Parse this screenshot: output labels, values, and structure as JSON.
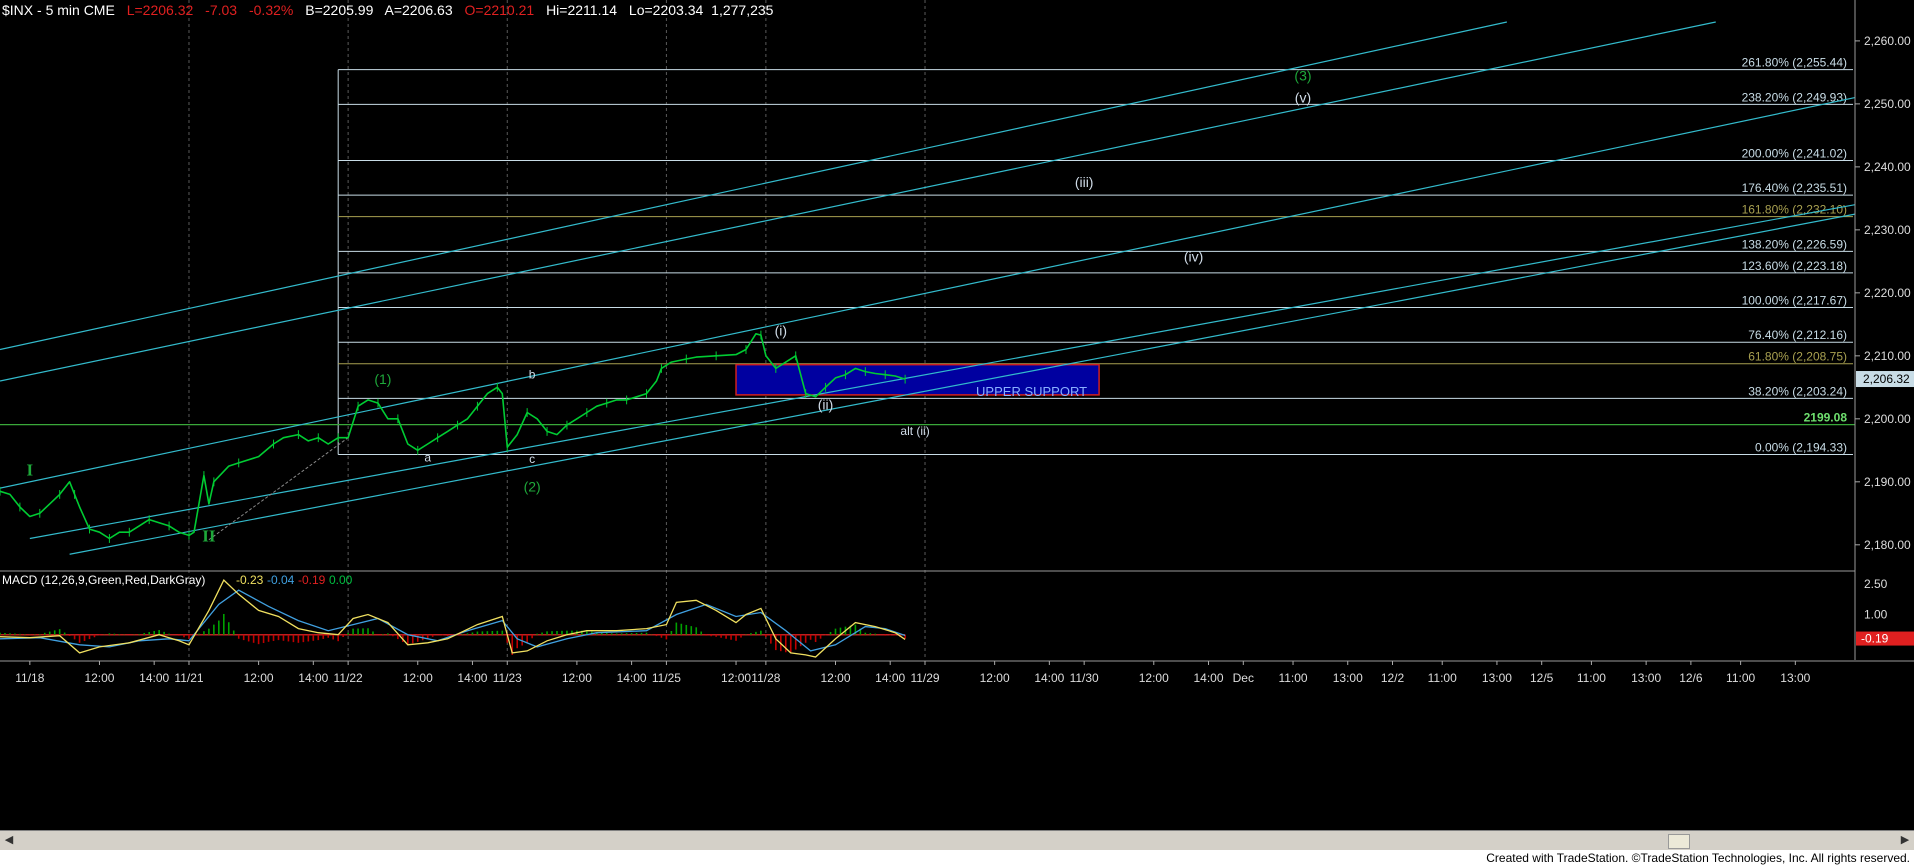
{
  "header": {
    "symbol": "$INX - 5 min  CME",
    "last": "L=2206.32",
    "change": "-7.03",
    "change_pct": "-0.32%",
    "bid": "B=2205.99",
    "ask": "A=2206.63",
    "open": "O=2210.21",
    "high": "Hi=2211.14",
    "low": "Lo=2203.34",
    "volume": "1,277,235"
  },
  "colors": {
    "background": "#000000",
    "price": "#00cc33",
    "channel": "#33bbcc",
    "fib_line": "#c8dce6",
    "fib_gold": "#a8a050",
    "support_fill": "#0000a0",
    "support_border": "#d02020",
    "macd": "#f0e060",
    "signal": "#40a0e0",
    "hist_pos": "#00a000",
    "hist_neg": "#c00000",
    "wave_green": "#1ea83a",
    "wave_white": "#d0dce8"
  },
  "chart_data": {
    "type": "line",
    "title": "$INX - 5 min",
    "price_axis": {
      "ticks": [
        "2,260.00",
        "2,250.00",
        "2,240.00",
        "2,230.00",
        "2,220.00",
        "2,210.00",
        "2,200.00",
        "2,190.00",
        "2,180.00"
      ],
      "values": [
        2260,
        2250,
        2240,
        2230,
        2220,
        2210,
        2200,
        2190,
        2180
      ],
      "ylim": [
        2176,
        2263
      ],
      "last_price": "2,206.32"
    },
    "time_axis": {
      "labels": [
        "11/18",
        "12:00",
        "14:00",
        "11/21",
        "12:00",
        "14:00",
        "11/22",
        "12:00",
        "14:00",
        "11/23",
        "12:00",
        "14:00",
        "11/25",
        "12:00",
        "11/28",
        "12:00",
        "14:00",
        "11/29",
        "12:00",
        "14:00",
        "11/30",
        "12:00",
        "14:00",
        "Dec",
        "11:00",
        "13:00",
        "12/2",
        "11:00",
        "13:00",
        "12/5",
        "11:00",
        "13:00",
        "12/6",
        "11:00",
        "13:00"
      ],
      "bar_index": [
        6,
        20,
        31,
        38,
        52,
        63,
        70,
        84,
        95,
        102,
        116,
        127,
        134,
        148,
        154,
        168,
        179,
        186,
        200,
        211,
        218,
        232,
        243,
        250,
        260,
        271,
        280,
        290,
        301,
        310,
        320,
        331,
        340,
        350,
        361
      ]
    },
    "series": [
      {
        "name": "$INX",
        "points": [
          [
            0,
            2188.5
          ],
          [
            2,
            2188
          ],
          [
            4,
            2186
          ],
          [
            6,
            2184.5
          ],
          [
            8,
            2185
          ],
          [
            10,
            2186.5
          ],
          [
            12,
            2188
          ],
          [
            14,
            2190
          ],
          [
            15,
            2188
          ],
          [
            16,
            2186
          ],
          [
            18,
            2182.5
          ],
          [
            20,
            2182
          ],
          [
            22,
            2181
          ],
          [
            24,
            2182
          ],
          [
            26,
            2182
          ],
          [
            28,
            2183
          ],
          [
            30,
            2184
          ],
          [
            32,
            2183.5
          ],
          [
            34,
            2183
          ],
          [
            36,
            2182
          ],
          [
            38,
            2181.5
          ],
          [
            39,
            2182
          ],
          [
            41,
            2191
          ],
          [
            42,
            2186.5
          ],
          [
            43,
            2190
          ],
          [
            46,
            2192.5
          ],
          [
            48,
            2193
          ],
          [
            52,
            2194
          ],
          [
            55,
            2196
          ],
          [
            57,
            2197
          ],
          [
            60,
            2197.5
          ],
          [
            62,
            2196.5
          ],
          [
            64,
            2197
          ],
          [
            66,
            2196
          ],
          [
            68,
            2197
          ],
          [
            70,
            2197
          ],
          [
            72,
            2202
          ],
          [
            74,
            2203
          ],
          [
            76,
            2202.5
          ],
          [
            78,
            2200
          ],
          [
            80,
            2200
          ],
          [
            82,
            2196
          ],
          [
            84,
            2195
          ],
          [
            86,
            2196
          ],
          [
            88,
            2197
          ],
          [
            90,
            2198
          ],
          [
            92,
            2199
          ],
          [
            94,
            2200
          ],
          [
            96,
            2202
          ],
          [
            98,
            2204
          ],
          [
            100,
            2205
          ],
          [
            101,
            2204
          ],
          [
            102,
            2195.5
          ],
          [
            104,
            2197.5
          ],
          [
            106,
            2201
          ],
          [
            108,
            2200
          ],
          [
            110,
            2198
          ],
          [
            112,
            2197.5
          ],
          [
            114,
            2199
          ],
          [
            116,
            2200
          ],
          [
            118,
            2201
          ],
          [
            120,
            2202
          ],
          [
            122,
            2202.5
          ],
          [
            124,
            2203
          ],
          [
            126,
            2203
          ],
          [
            128,
            2203.5
          ],
          [
            130,
            2204
          ],
          [
            132,
            2206
          ],
          [
            133,
            2208
          ],
          [
            135,
            2209
          ],
          [
            138,
            2209.5
          ],
          [
            140,
            2209.8
          ],
          [
            144,
            2210
          ],
          [
            148,
            2210.2
          ],
          [
            150,
            2211
          ],
          [
            152,
            2213.5
          ],
          [
            153,
            2213.3
          ],
          [
            154,
            2210
          ],
          [
            156,
            2208
          ],
          [
            158,
            2209
          ],
          [
            160,
            2210
          ],
          [
            161,
            2207
          ],
          [
            162,
            2204
          ],
          [
            164,
            2203.5
          ],
          [
            166,
            2205
          ],
          [
            168,
            2206.5
          ],
          [
            170,
            2207
          ],
          [
            172,
            2208
          ],
          [
            174,
            2207.5
          ],
          [
            176,
            2207.2
          ],
          [
            178,
            2207
          ],
          [
            180,
            2206.8
          ],
          [
            182,
            2206.3
          ]
        ]
      }
    ],
    "fib_levels": [
      {
        "label": "261.80% (2,255.44)",
        "value": 2255.44,
        "gold": false
      },
      {
        "label": "238.20% (2,249.93)",
        "value": 2249.93,
        "gold": false
      },
      {
        "label": "200.00% (2,241.02)",
        "value": 2241.02,
        "gold": false
      },
      {
        "label": "176.40% (2,235.51)",
        "value": 2235.51,
        "gold": false
      },
      {
        "label": "161.80% (2,232.10)",
        "value": 2232.1,
        "gold": true
      },
      {
        "label": "138.20% (2,226.59)",
        "value": 2226.59,
        "gold": false
      },
      {
        "label": "123.60% (2,223.18)",
        "value": 2223.18,
        "gold": false
      },
      {
        "label": "100.00% (2,217.67)",
        "value": 2217.67,
        "gold": false
      },
      {
        "label": "76.40% (2,212.16)",
        "value": 2212.16,
        "gold": false
      },
      {
        "label": "61.80% (2,208.75)",
        "value": 2208.75,
        "gold": true
      },
      {
        "label": "38.20% (2,203.24)",
        "value": 2203.24,
        "gold": false
      },
      {
        "label": "0.00% (2,194.33)",
        "value": 2194.33,
        "gold": false
      }
    ],
    "horizontal_line": {
      "label": "2199.08",
      "value": 2199.08
    },
    "support_zone": {
      "label": "UPPER SUPPORT",
      "start_bar": 148,
      "end_bar": 221,
      "low": 2203.8,
      "high": 2208.6
    },
    "channels": [
      {
        "from": [
          0,
          2211
        ],
        "to": [
          303,
          2263
        ]
      },
      {
        "from": [
          0,
          2206
        ],
        "to": [
          345,
          2263
        ]
      },
      {
        "from": [
          0,
          2189
        ],
        "to": [
          373,
          2251
        ]
      },
      {
        "from": [
          6,
          2181
        ],
        "to": [
          373,
          2234
        ]
      },
      {
        "from": [
          14,
          2178.5
        ],
        "to": [
          373,
          2232.5
        ]
      }
    ],
    "wave_labels": [
      {
        "text": "I",
        "bar": 6,
        "price": 2191,
        "color": "green",
        "size": "big"
      },
      {
        "text": "II",
        "bar": 42,
        "price": 2180.5,
        "color": "green",
        "size": "big"
      },
      {
        "text": "(1)",
        "bar": 77,
        "price": 2205.5,
        "color": "green",
        "size": "mid"
      },
      {
        "text": "a",
        "bar": 86,
        "price": 2193.2,
        "color": "white",
        "size": "small"
      },
      {
        "text": "b",
        "bar": 107,
        "price": 2206.4,
        "color": "white",
        "size": "small"
      },
      {
        "text": "c",
        "bar": 107,
        "price": 2193,
        "color": "white",
        "size": "small"
      },
      {
        "text": "(2)",
        "bar": 107,
        "price": 2188.5,
        "color": "green",
        "size": "mid"
      },
      {
        "text": "(i)",
        "bar": 157,
        "price": 2213.2,
        "color": "white",
        "size": "mid"
      },
      {
        "text": "(ii)",
        "bar": 166,
        "price": 2201.5,
        "color": "white",
        "size": "mid"
      },
      {
        "text": "alt (ii)",
        "bar": 184,
        "price": 2197.4,
        "color": "white",
        "size": "small"
      },
      {
        "text": "(iii)",
        "bar": 218,
        "price": 2236.8,
        "color": "white",
        "size": "mid"
      },
      {
        "text": "(iv)",
        "bar": 240,
        "price": 2225,
        "color": "white",
        "size": "mid"
      },
      {
        "text": "(v)",
        "bar": 262,
        "price": 2250.2,
        "color": "white",
        "size": "mid"
      },
      {
        "text": "(3)",
        "bar": 262,
        "price": 2253.7,
        "color": "green",
        "size": "mid"
      }
    ],
    "vertical_markers": [
      38,
      70,
      102,
      134,
      154,
      186
    ],
    "macd": {
      "label": "MACD (12,26,9,Green,Red,DarkGray)",
      "values": [
        "-0.23",
        "-0.04",
        "-0.19",
        "0.00"
      ],
      "value_colors": [
        "#f0e060",
        "#40a0e0",
        "#e02020",
        "#00c040"
      ],
      "ticks": [
        "2.50",
        "1.00"
      ],
      "tick_values": [
        2.5,
        1.0
      ],
      "ylim": [
        -1.25,
        3.1
      ],
      "current": "-0.19",
      "macd_points": [
        [
          0,
          -0.1
        ],
        [
          6,
          -0.15
        ],
        [
          12,
          -0.05
        ],
        [
          16,
          -0.9
        ],
        [
          20,
          -0.6
        ],
        [
          26,
          -0.4
        ],
        [
          32,
          0.0
        ],
        [
          36,
          -0.3
        ],
        [
          38,
          -0.5
        ],
        [
          42,
          1.2
        ],
        [
          45,
          2.7
        ],
        [
          48,
          2.0
        ],
        [
          52,
          1.2
        ],
        [
          56,
          0.9
        ],
        [
          60,
          0.3
        ],
        [
          64,
          0.1
        ],
        [
          68,
          0.0
        ],
        [
          71,
          0.8
        ],
        [
          74,
          1.0
        ],
        [
          78,
          0.6
        ],
        [
          82,
          -0.5
        ],
        [
          86,
          -0.4
        ],
        [
          90,
          -0.2
        ],
        [
          96,
          0.5
        ],
        [
          101,
          0.9
        ],
        [
          103,
          -0.9
        ],
        [
          106,
          -0.8
        ],
        [
          110,
          -0.3
        ],
        [
          114,
          0.0
        ],
        [
          118,
          0.2
        ],
        [
          124,
          0.2
        ],
        [
          130,
          0.3
        ],
        [
          134,
          0.5
        ],
        [
          136,
          1.6
        ],
        [
          140,
          1.7
        ],
        [
          144,
          1.2
        ],
        [
          148,
          0.6
        ],
        [
          150,
          1.0
        ],
        [
          153,
          1.3
        ],
        [
          156,
          -0.2
        ],
        [
          159,
          -0.9
        ],
        [
          162,
          -1.0
        ],
        [
          164,
          -1.1
        ],
        [
          168,
          -0.2
        ],
        [
          172,
          0.6
        ],
        [
          176,
          0.4
        ],
        [
          180,
          0.1
        ],
        [
          182,
          -0.23
        ]
      ],
      "signal_points": [
        [
          0,
          -0.2
        ],
        [
          8,
          -0.15
        ],
        [
          16,
          -0.5
        ],
        [
          22,
          -0.6
        ],
        [
          28,
          -0.3
        ],
        [
          34,
          -0.2
        ],
        [
          38,
          -0.3
        ],
        [
          44,
          1.5
        ],
        [
          48,
          2.2
        ],
        [
          54,
          1.4
        ],
        [
          60,
          0.7
        ],
        [
          66,
          0.2
        ],
        [
          71,
          0.5
        ],
        [
          76,
          0.8
        ],
        [
          82,
          0.0
        ],
        [
          88,
          -0.3
        ],
        [
          94,
          0.2
        ],
        [
          101,
          0.7
        ],
        [
          104,
          -0.2
        ],
        [
          108,
          -0.6
        ],
        [
          114,
          -0.2
        ],
        [
          120,
          0.1
        ],
        [
          130,
          0.2
        ],
        [
          136,
          1.0
        ],
        [
          142,
          1.5
        ],
        [
          148,
          0.9
        ],
        [
          153,
          1.1
        ],
        [
          158,
          0.2
        ],
        [
          163,
          -0.8
        ],
        [
          168,
          -0.5
        ],
        [
          174,
          0.4
        ],
        [
          178,
          0.3
        ],
        [
          182,
          -0.04
        ]
      ]
    },
    "grid": true,
    "bars_total": 373
  },
  "footer": {
    "credit": "Created with TradeStation. ©TradeStation Technologies, Inc. All rights reserved."
  }
}
